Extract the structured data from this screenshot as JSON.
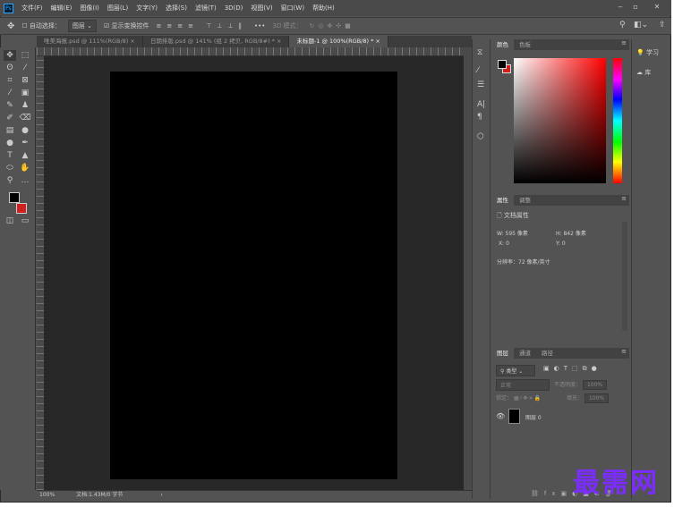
{
  "menu": {
    "logo": "Ps",
    "items": [
      "文件(F)",
      "编辑(E)",
      "图像(I)",
      "图层(L)",
      "文字(Y)",
      "选择(S)",
      "滤镜(T)",
      "3D(D)",
      "视图(V)",
      "窗口(W)",
      "帮助(H)"
    ],
    "minimize": "‒",
    "maximize": "▫",
    "close": "✕"
  },
  "options": {
    "auto_select": "自动选择：",
    "layer_select": "图层",
    "show_transform": "显示变换控件",
    "more": "•••",
    "mode_3d": "3D 模式："
  },
  "tabs": [
    "唯美海报.psd @ 111%(RGB/8)",
    "日期排版.psd @ 141% (组 2 拷贝, RGB/8#) *",
    "未标题-1 @ 100%(RGB/8) *"
  ],
  "status": {
    "zoom": "100%",
    "doc": "文档:1.43M/0 字节",
    "arrow": "›"
  },
  "color_panel": {
    "tabs": [
      "颜色",
      "色板"
    ],
    "foreground": "#000000",
    "background": "#d01f1f"
  },
  "properties": {
    "tabs": [
      "属性",
      "调整"
    ],
    "title": "文档属性",
    "w_label": "W:",
    "w": "595 像素",
    "h_label": "H:",
    "h": "842 像素",
    "x_label": "X:",
    "x": "0",
    "y_label": "Y:",
    "y": "0",
    "resolution": "分辨率：72 像素/英寸"
  },
  "layers": {
    "tabs": [
      "图层",
      "通道",
      "路径"
    ],
    "filter": "类型",
    "blend": "正常",
    "opacity_label": "不透明度：",
    "opacity": "100%",
    "lock_label": "锁定：",
    "fill_label": "填充：",
    "fill": "100%",
    "layer_name": "图层 0"
  },
  "right": {
    "learn": "学习",
    "library": "库"
  },
  "watermark": "最需网"
}
